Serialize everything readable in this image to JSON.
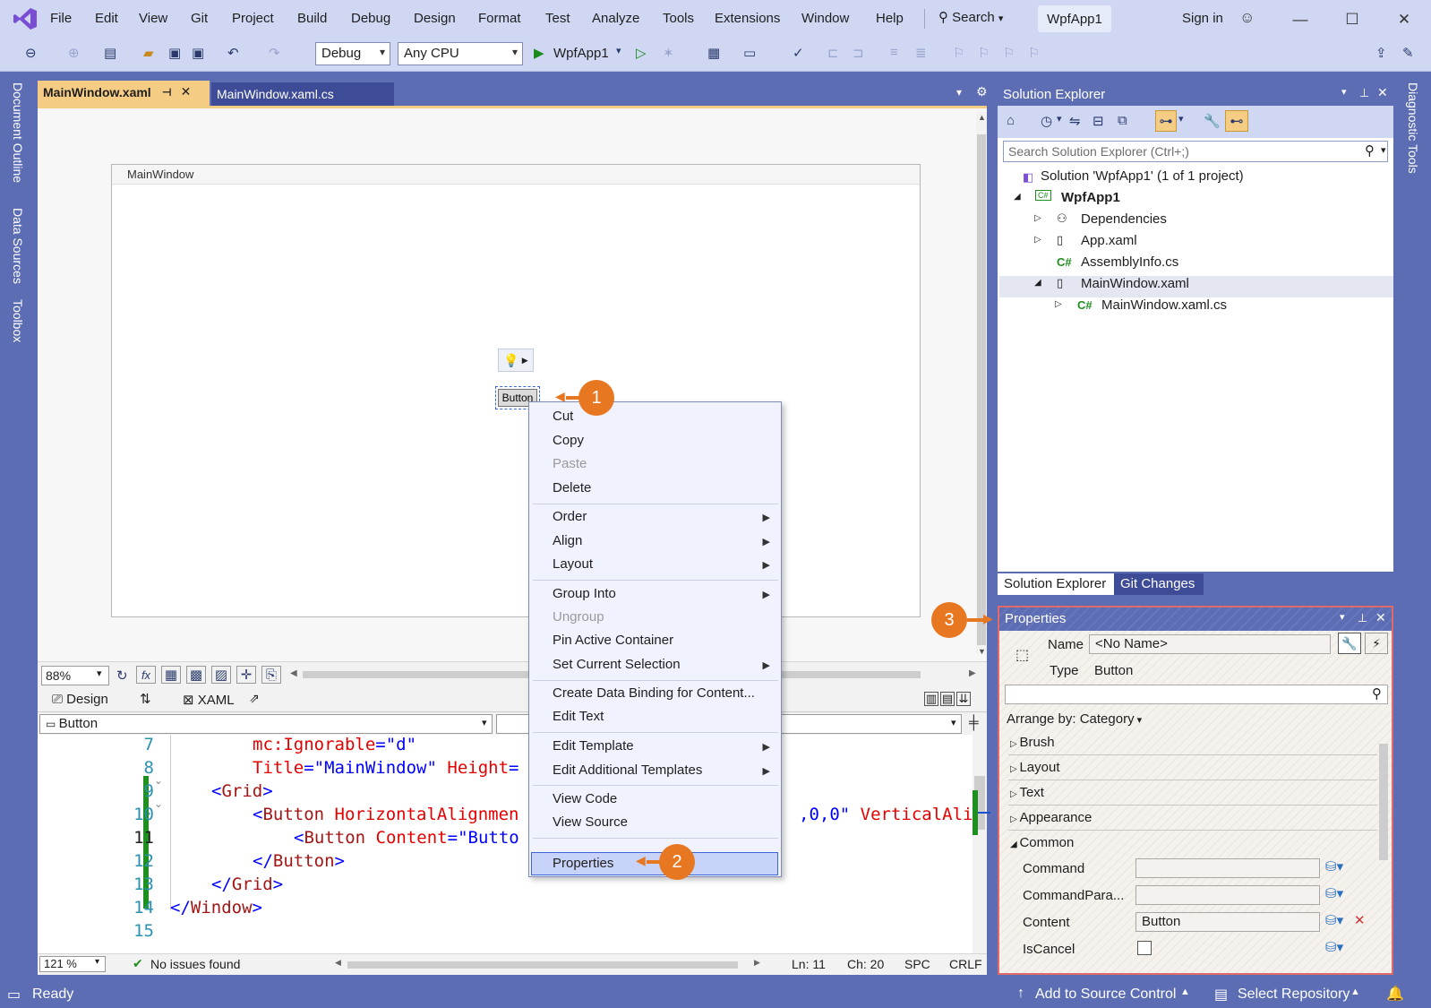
{
  "menubar": {
    "items": [
      "File",
      "Edit",
      "View",
      "Git",
      "Project",
      "Build",
      "Debug",
      "Design",
      "Format",
      "Test",
      "Analyze",
      "Tools",
      "Extensions",
      "Window",
      "Help"
    ],
    "search_label": "Search",
    "solution_name": "WpfApp1",
    "sign_in": "Sign in"
  },
  "toolbar": {
    "config": "Debug",
    "platform": "Any CPU",
    "run_target": "WpfApp1"
  },
  "side_tabs": [
    "Document Outline",
    "Data Sources",
    "Toolbox"
  ],
  "right_side_tab": "Diagnostic Tools",
  "doc_tabs": {
    "active": "MainWindow.xaml",
    "other": "MainWindow.xaml.cs"
  },
  "designer": {
    "window_title": "MainWindow",
    "button_label": "Button",
    "zoom": "88%",
    "design_tab": "Design",
    "xaml_tab": "XAML",
    "element_selector": "Button"
  },
  "code": {
    "line_numbers": [
      "7",
      "8",
      "9",
      "10",
      "11",
      "12",
      "13",
      "14",
      "15"
    ],
    "zoom": "121 %",
    "issues": "No issues found",
    "line": "Ln: 11",
    "col": "Ch: 20",
    "spc": "SPC",
    "crlf": "CRLF"
  },
  "context_menu": {
    "items": [
      "Cut",
      "Copy",
      "Paste",
      "Delete",
      "Order",
      "Align",
      "Layout",
      "Group Into",
      "Ungroup",
      "Pin Active Container",
      "Set Current Selection",
      "Create Data Binding for Content...",
      "Edit Text",
      "Edit Template",
      "Edit Additional Templates",
      "View Code",
      "View Source",
      "Properties"
    ],
    "disabled": [
      "Paste",
      "Ungroup"
    ]
  },
  "callouts": [
    "1",
    "2",
    "3"
  ],
  "solution_explorer": {
    "title": "Solution Explorer",
    "search_placeholder": "Search Solution Explorer (Ctrl+;)",
    "tree": [
      "Solution 'WpfApp1' (1 of 1 project)",
      "WpfApp1",
      "Dependencies",
      "App.xaml",
      "AssemblyInfo.cs",
      "MainWindow.xaml",
      "MainWindow.xaml.cs"
    ],
    "tab1": "Solution Explorer",
    "tab2": "Git Changes"
  },
  "properties": {
    "title": "Properties",
    "name_label": "Name",
    "name_value": "<No Name>",
    "type_label": "Type",
    "type_value": "Button",
    "arrange_by": "Arrange by: Category",
    "categories": [
      "Brush",
      "Layout",
      "Text",
      "Appearance",
      "Common"
    ],
    "common_props": [
      "Command",
      "CommandPara...",
      "Content",
      "IsCancel"
    ],
    "content_value": "Button"
  },
  "statusbar": {
    "ready": "Ready",
    "add_source": "Add to Source Control",
    "select_repo": "Select Repository"
  }
}
